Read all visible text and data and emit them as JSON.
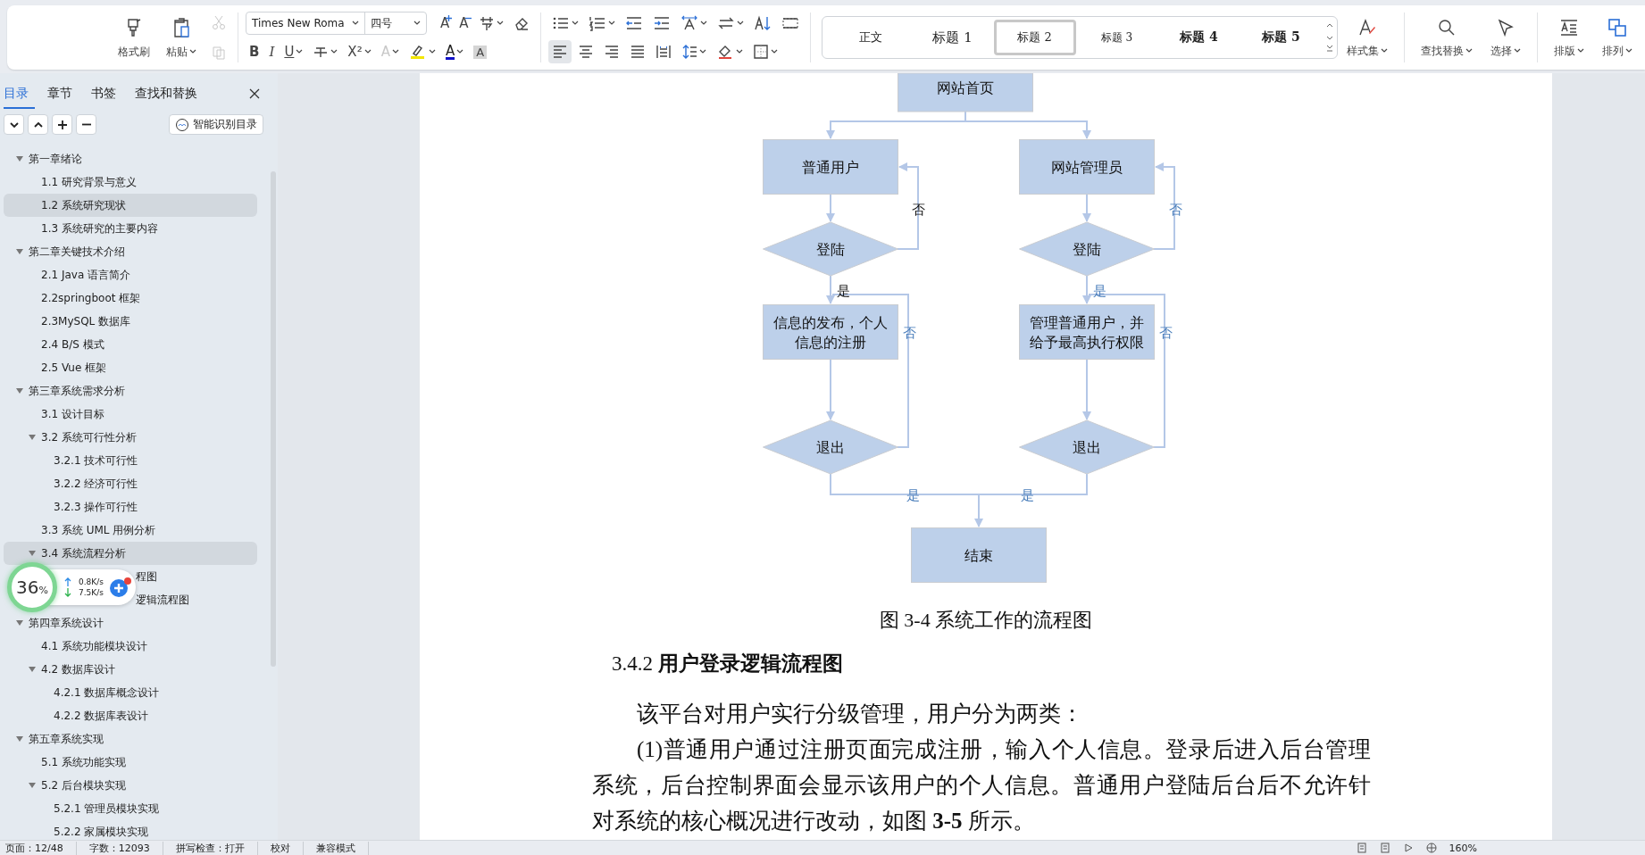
{
  "ribbon": {
    "big_buttons": [
      {
        "kind": "format-painter",
        "label": "格式刷",
        "dropdown": false
      },
      {
        "kind": "paste",
        "label": "粘贴",
        "dropdown": true
      }
    ],
    "clipboard_small": [
      {
        "kind": "cut",
        "disabled": true
      },
      {
        "kind": "copy",
        "disabled": true
      }
    ],
    "font_name": "Times New Roma",
    "font_size": "四号",
    "font_row1": [
      {
        "kind": "grow-font",
        "glyph": "A",
        "dropdown": false,
        "disabled": false
      },
      {
        "kind": "shrink-font",
        "glyph": "A",
        "dropdown": false,
        "disabled": false
      },
      {
        "kind": "phonetic",
        "dropdown": true,
        "disabled": false
      },
      {
        "kind": "eraser",
        "dropdown": false,
        "disabled": false
      }
    ],
    "font_row2": [
      {
        "kind": "bold",
        "glyph": "B",
        "dropdown": false,
        "disabled": false
      },
      {
        "kind": "italic",
        "glyph": "I",
        "dropdown": false,
        "disabled": false
      },
      {
        "kind": "underline",
        "glyph": "U",
        "dropdown": true,
        "disabled": false
      },
      {
        "kind": "strike",
        "dropdown": true,
        "disabled": false
      },
      {
        "kind": "superscript",
        "glyph": "X²",
        "dropdown": true,
        "disabled": false
      },
      {
        "kind": "text-effect",
        "glyph": "A",
        "dropdown": true,
        "disabled": true
      },
      {
        "kind": "highlight",
        "dropdown": true,
        "disabled": false
      },
      {
        "kind": "font-color",
        "glyph": "A",
        "dropdown": true,
        "disabled": false
      },
      {
        "kind": "char-shading",
        "glyph": "A",
        "dropdown": false,
        "disabled": false
      }
    ],
    "para_row1": [
      {
        "kind": "bullets",
        "dropdown": true,
        "selected": false
      },
      {
        "kind": "numbering",
        "dropdown": true,
        "selected": false
      },
      {
        "kind": "outdent",
        "dropdown": false,
        "selected": false
      },
      {
        "kind": "indent",
        "dropdown": false,
        "selected": false
      },
      {
        "kind": "text-direction",
        "dropdown": true,
        "selected": false
      },
      {
        "kind": "swap",
        "dropdown": true,
        "selected": false
      },
      {
        "kind": "sort",
        "dropdown": false,
        "selected": false
      },
      {
        "kind": "table-border",
        "dropdown": false,
        "selected": false
      }
    ],
    "para_row2": [
      {
        "kind": "align-left",
        "dropdown": false,
        "selected": true
      },
      {
        "kind": "align-center",
        "dropdown": false,
        "selected": false
      },
      {
        "kind": "align-right",
        "dropdown": false,
        "selected": false
      },
      {
        "kind": "justify",
        "dropdown": false,
        "selected": false
      },
      {
        "kind": "distribute",
        "dropdown": false,
        "selected": false
      },
      {
        "kind": "line-spacing",
        "dropdown": true,
        "selected": false
      },
      {
        "kind": "fill",
        "dropdown": true,
        "selected": false
      },
      {
        "kind": "borders",
        "dropdown": true,
        "selected": false
      }
    ],
    "styles": [
      {
        "kind": "body",
        "label": "正文",
        "selected": false
      },
      {
        "kind": "h1",
        "label": "标题 1",
        "selected": false
      },
      {
        "kind": "h2",
        "label": "标题 2",
        "selected": true
      },
      {
        "kind": "h3",
        "label": "标题 3",
        "selected": false
      },
      {
        "kind": "h4",
        "label": "标题 4",
        "selected": false
      },
      {
        "kind": "h5",
        "label": "标题 5",
        "selected": false
      }
    ],
    "right_buttons": [
      {
        "kind": "style-set",
        "label": "样式集",
        "dropdown": true
      },
      {
        "kind": "find-replace",
        "label": "查找替换",
        "dropdown": true
      },
      {
        "kind": "select",
        "label": "选择",
        "dropdown": true
      },
      {
        "kind": "layout",
        "label": "排版",
        "dropdown": true
      },
      {
        "kind": "arrange",
        "label": "排列",
        "dropdown": true
      }
    ]
  },
  "sidebar": {
    "tabs": [
      {
        "label": "目录",
        "selected": true
      },
      {
        "label": "章节",
        "selected": false
      },
      {
        "label": "书签",
        "selected": false
      },
      {
        "label": "查找和替换",
        "selected": false
      }
    ],
    "tool_buttons": [
      {
        "kind": "down"
      },
      {
        "kind": "up"
      },
      {
        "kind": "plus"
      },
      {
        "kind": "minus"
      }
    ],
    "smart_button": "智能识别目录",
    "outline": [
      {
        "kind": "heading",
        "label": "第一章绪论",
        "expanded": true,
        "selected": false,
        "children": [
          {
            "kind": "heading",
            "label": "1.1 研究背景与意义",
            "selected": false
          },
          {
            "kind": "heading",
            "label": "1.2 系统研究现状",
            "selected": true
          },
          {
            "kind": "heading",
            "label": "1.3 系统研究的主要内容",
            "selected": false
          }
        ]
      },
      {
        "kind": "heading",
        "label": "第二章关键技术介绍",
        "expanded": true,
        "selected": false,
        "children": [
          {
            "kind": "heading",
            "label": "2.1 Java 语言简介",
            "selected": false
          },
          {
            "kind": "heading",
            "label": "2.2springboot 框架",
            "selected": false
          },
          {
            "kind": "heading",
            "label": "2.3MySQL 数据库",
            "selected": false
          },
          {
            "kind": "heading",
            "label": "2.4 B/S 模式",
            "selected": false
          },
          {
            "kind": "heading",
            "label": "2.5 Vue 框架",
            "selected": false
          }
        ]
      },
      {
        "kind": "heading",
        "label": "第三章系统需求分析",
        "expanded": true,
        "selected": false,
        "children": [
          {
            "kind": "heading",
            "label": "3.1 设计目标",
            "selected": false
          },
          {
            "kind": "heading",
            "label": "3.2 系统可行性分析",
            "expanded": true,
            "selected": false,
            "children": [
              {
                "kind": "heading",
                "label": "3.2.1 技术可行性",
                "selected": false
              },
              {
                "kind": "heading",
                "label": "3.2.2 经济可行性",
                "selected": false
              },
              {
                "kind": "heading",
                "label": "3.2.3 操作可行性",
                "selected": false
              }
            ]
          },
          {
            "kind": "heading",
            "label": "3.3 系统 UML 用例分析",
            "selected": false
          },
          {
            "kind": "heading",
            "label": "3.4 系统流程分析",
            "expanded": true,
            "selected": true,
            "children": [
              {
                "kind": "obscured",
                "label": "程图",
                "selected": false
              },
              {
                "kind": "obscured",
                "label": "逻辑流程图",
                "selected": false
              }
            ]
          }
        ]
      },
      {
        "kind": "heading",
        "label": "第四章系统设计",
        "expanded": true,
        "selected": false,
        "children": [
          {
            "kind": "heading",
            "label": "4.1 系统功能模块设计",
            "selected": false
          },
          {
            "kind": "heading",
            "label": "4.2 数据库设计",
            "expanded": true,
            "selected": false,
            "children": [
              {
                "kind": "heading",
                "label": "4.2.1 数据库概念设计",
                "selected": false
              },
              {
                "kind": "heading",
                "label": "4.2.2  数据库表设计",
                "selected": false
              }
            ]
          }
        ]
      },
      {
        "kind": "heading",
        "label": "第五章系统实现",
        "expanded": true,
        "selected": false,
        "children": [
          {
            "kind": "heading",
            "label": "5.1 系统功能实现",
            "selected": false
          },
          {
            "kind": "heading",
            "label": "5.2 后台模块实现",
            "expanded": true,
            "selected": false,
            "children": [
              {
                "kind": "heading",
                "label": "5.2.1 管理员模块实现",
                "selected": false
              },
              {
                "kind": "heading",
                "label": "5.2.2 家属模块实现",
                "selected": false
              }
            ]
          }
        ]
      }
    ]
  },
  "net_widget": {
    "percent": "36",
    "unit": "%",
    "upload": "0.8K/s",
    "download": "7.5K/s"
  },
  "document": {
    "flowchart": {
      "nodes": [
        {
          "kind": "box",
          "lines": [
            "网站首页"
          ]
        },
        {
          "kind": "box",
          "lines": [
            "普通用户"
          ]
        },
        {
          "kind": "box",
          "lines": [
            "网站管理员"
          ]
        },
        {
          "kind": "diamond",
          "lines": [
            "登陆"
          ]
        },
        {
          "kind": "diamond",
          "lines": [
            "登陆"
          ]
        },
        {
          "kind": "box",
          "lines": [
            "信息的发布，个人",
            "信息的注册"
          ]
        },
        {
          "kind": "box",
          "lines": [
            "管理普通用户，并",
            "给予最高执行权限"
          ]
        },
        {
          "kind": "diamond",
          "lines": [
            "退出"
          ]
        },
        {
          "kind": "diamond",
          "lines": [
            "退出"
          ]
        },
        {
          "kind": "box",
          "lines": [
            "结束"
          ]
        }
      ],
      "edge_labels": [
        {
          "text": "否",
          "color": "#111111"
        },
        {
          "text": "否",
          "color": "#4a7ebb"
        },
        {
          "text": "是",
          "color": "#111111"
        },
        {
          "text": "是",
          "color": "#4a7ebb"
        },
        {
          "text": "否",
          "color": "#4a7ebb"
        },
        {
          "text": "否",
          "color": "#4a7ebb"
        },
        {
          "text": "是",
          "color": "#4a7ebb"
        },
        {
          "text": "是",
          "color": "#4a7ebb"
        }
      ]
    },
    "caption": "图 3-4 系统工作的流程图",
    "heading": "3.4.2 **用户登录逻辑流程图**",
    "paragraphs": [
      "该平台对用户实行分级管理，用户分为两类：",
      "(1)普通用户通过注册页面完成注册，输入个人信息。登录后进入后台管理系统，后台控制界面会显示该用户的个人信息。普通用户登陆后台后不允许针对系统的核心概况进行改动，如图 **3-5** 所示。"
    ]
  },
  "status_bar": {
    "items": [
      "页面：12/48",
      "字数：12093",
      "拼写检查：打开",
      "校对",
      "兼容模式"
    ],
    "zoom": "160%"
  }
}
